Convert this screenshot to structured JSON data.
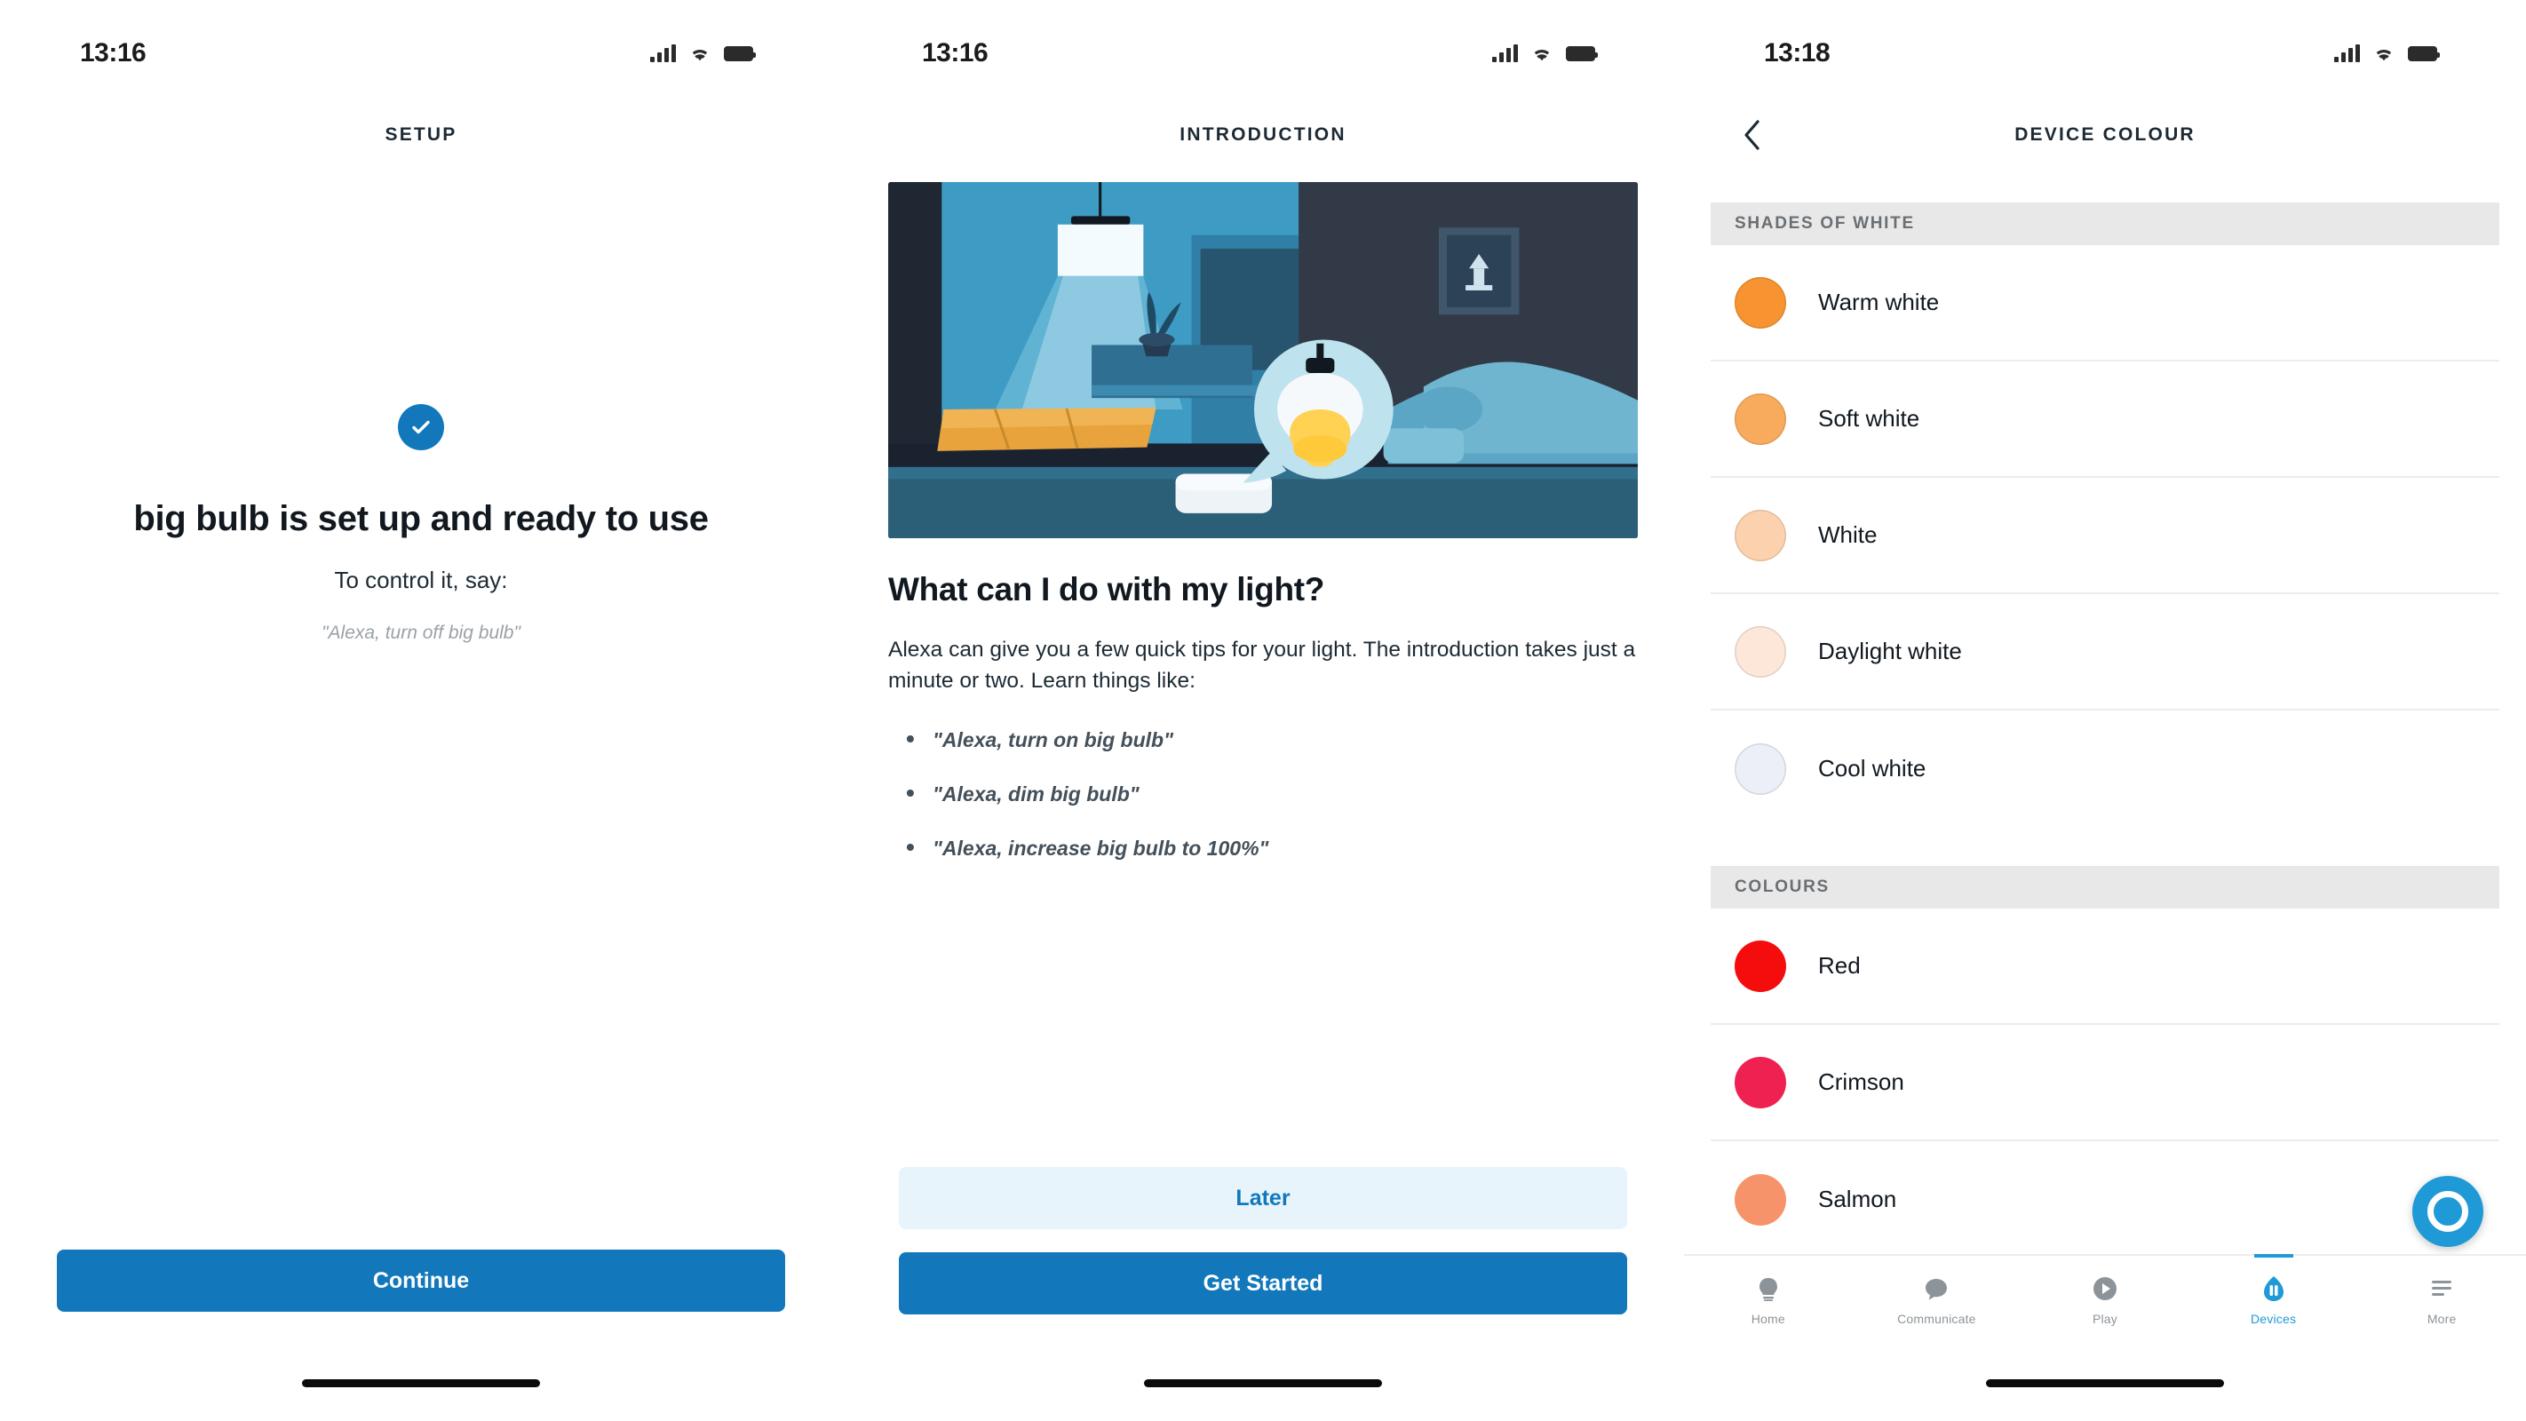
{
  "theme": {
    "accent_blue": "#1278bb",
    "alexa_blue": "#1f9ad6",
    "secondary_button_bg": "#e7f4fc",
    "section_header_bg": "#e8e8e8",
    "text_dark": "#11181f",
    "text_muted": "#9aa2a8"
  },
  "screen1": {
    "status": {
      "time": "13:16",
      "signal_icon": "cellular-bars-icon",
      "wifi_icon": "wifi-icon",
      "battery_icon": "battery-icon"
    },
    "nav": {
      "title": "SETUP"
    },
    "success_icon": "check-circle-icon",
    "title": "big bulb is set up and ready to use",
    "subtitle": "To control it, say:",
    "quote": "\"Alexa, turn off big bulb\"",
    "primary_button": "Continue"
  },
  "screen2": {
    "status": {
      "time": "13:16",
      "signal_icon": "cellular-bars-icon",
      "wifi_icon": "wifi-icon",
      "battery_icon": "battery-icon"
    },
    "nav": {
      "title": "INTRODUCTION"
    },
    "illustration": "bedroom-smart-light-illustration",
    "heading": "What can I do with my light?",
    "paragraph": "Alexa can give you a few quick tips for your light. The introduction takes just a minute or two. Learn things like:",
    "bullets": [
      "\"Alexa, turn on big bulb\"",
      "\"Alexa, dim big bulb\"",
      "\"Alexa, increase big bulb to 100%\""
    ],
    "secondary_button": "Later",
    "primary_button": "Get Started"
  },
  "screen3": {
    "status": {
      "time": "13:18",
      "signal_icon": "cellular-bars-icon",
      "wifi_icon": "wifi-icon",
      "battery_icon": "battery-icon"
    },
    "nav": {
      "title": "DEVICE COLOUR",
      "back_icon": "chevron-left-icon"
    },
    "sections": [
      {
        "header": "SHADES OF WHITE",
        "items": [
          {
            "name": "Warm white",
            "swatch": "#f79431"
          },
          {
            "name": "Soft white",
            "swatch": "#f8ab5d"
          },
          {
            "name": "White",
            "swatch": "#fbd2ad"
          },
          {
            "name": "Daylight white",
            "swatch": "#fce7d8"
          },
          {
            "name": "Cool white",
            "swatch": "#eceef8"
          }
        ]
      },
      {
        "header": "COLOURS",
        "items": [
          {
            "name": "Red",
            "swatch": "#f50c0c"
          },
          {
            "name": "Crimson",
            "swatch": "#ef2150"
          },
          {
            "name": "Salmon",
            "swatch": "#f7936a"
          }
        ]
      }
    ],
    "fab": {
      "icon": "alexa-ring-icon",
      "label": "Alexa"
    },
    "tabs": [
      {
        "label": "Home",
        "icon": "home-icon",
        "active": false
      },
      {
        "label": "Communicate",
        "icon": "chat-bubble-icon",
        "active": false
      },
      {
        "label": "Play",
        "icon": "play-circle-icon",
        "active": false
      },
      {
        "label": "Devices",
        "icon": "devices-icon",
        "active": true
      },
      {
        "label": "More",
        "icon": "hamburger-icon",
        "active": false
      }
    ]
  }
}
